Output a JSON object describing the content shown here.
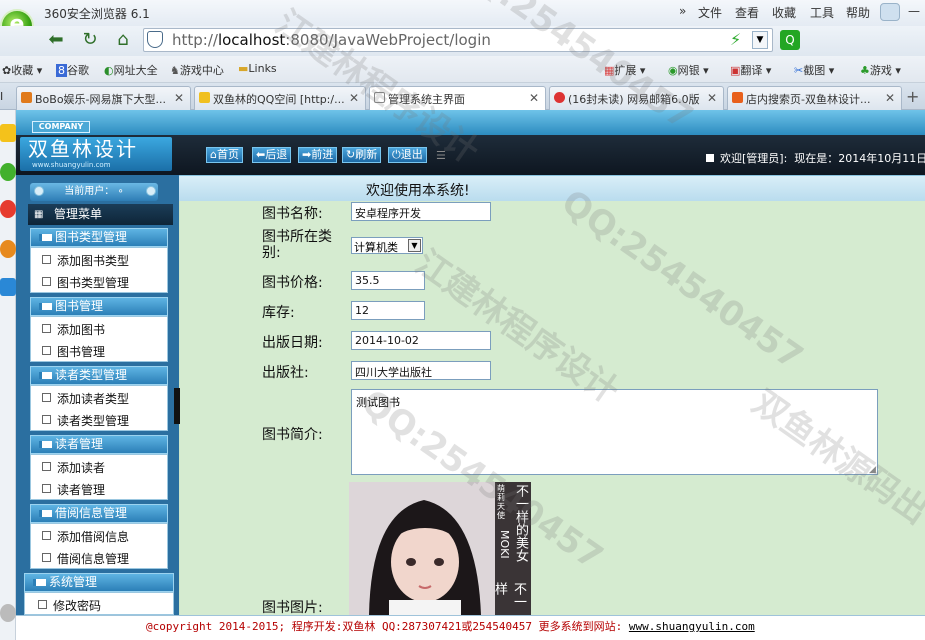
{
  "browser": {
    "app_title": "360安全浏览器 6.1",
    "menu": [
      "»",
      "文件",
      "查看",
      "收藏",
      "工具",
      "帮助"
    ],
    "url_prefix": "http://",
    "url_host": "localhost",
    "url_rest": ":8080/JavaWebProject/login",
    "bookmarks": [
      "收藏",
      "谷歌",
      "网址大全",
      "游戏中心",
      "Links"
    ],
    "right_tools": [
      "扩展",
      "网银",
      "翻译",
      "截图",
      "游戏"
    ],
    "tabs": [
      {
        "label": "BoBo娱乐-网易旗下大型..."
      },
      {
        "label": "双鱼林的QQ空间 [http:/..."
      },
      {
        "label": "管理系统主界面"
      },
      {
        "label": "(16封未读) 网易邮箱6.0版"
      },
      {
        "label": "店内搜索页-双鱼林设计..."
      }
    ],
    "new_tab": "+"
  },
  "app": {
    "company": "COMPANY",
    "brand": "双鱼林设计",
    "brand_sub": "www.shuangyulin.com",
    "nav": [
      "首页",
      "后退",
      "前进",
      "刷新",
      "退出"
    ],
    "welcome_user": "欢迎[管理员]:",
    "date_text": "现在是：2014年10月11日",
    "welcome_main": "欢迎使用本系统!",
    "current_user": "当前用户：",
    "menu_title": "管理菜单",
    "groups": [
      {
        "title": "图书类型管理",
        "items": [
          "添加图书类型",
          "图书类型管理"
        ]
      },
      {
        "title": "图书管理",
        "items": [
          "添加图书",
          "图书管理"
        ]
      },
      {
        "title": "读者类型管理",
        "items": [
          "添加读者类型",
          "读者类型管理"
        ]
      },
      {
        "title": "读者管理",
        "items": [
          "添加读者",
          "读者管理"
        ]
      },
      {
        "title": "借阅信息管理",
        "items": [
          "添加借阅信息",
          "借阅信息管理"
        ]
      },
      {
        "title": "系统管理",
        "items": [
          "修改密码"
        ]
      }
    ]
  },
  "form": {
    "book_name_label": "图书名称:",
    "book_name": "安卓程序开发",
    "category_label": "图书所在类别:",
    "category": "计算机类",
    "price_label": "图书价格:",
    "price": "35.5",
    "stock_label": "库存:",
    "stock": "12",
    "date_label": "出版日期:",
    "pub_date": "2014-10-02",
    "publisher_label": "出版社:",
    "publisher": "四川大学出版社",
    "intro_label": "图书简介:",
    "intro": "测试图书",
    "image_label": "图书图片:",
    "image_text": [
      "萌",
      "莉",
      "天",
      "使",
      "不一样的美女",
      "MOKI",
      "不一样"
    ]
  },
  "footer": {
    "text": "@copyright 2014-2015; 程序开发:双鱼林  QQ:287307421或254540457  更多系统到网站:",
    "link": "www.shuangyulin.com"
  },
  "watermarks": [
    "QQ:254540457",
    "江建林程序设计",
    "双鱼林源码出",
    "QQ:254540457",
    "江建林程序设计",
    "双鱼林源码出",
    "QQ:254540457"
  ]
}
